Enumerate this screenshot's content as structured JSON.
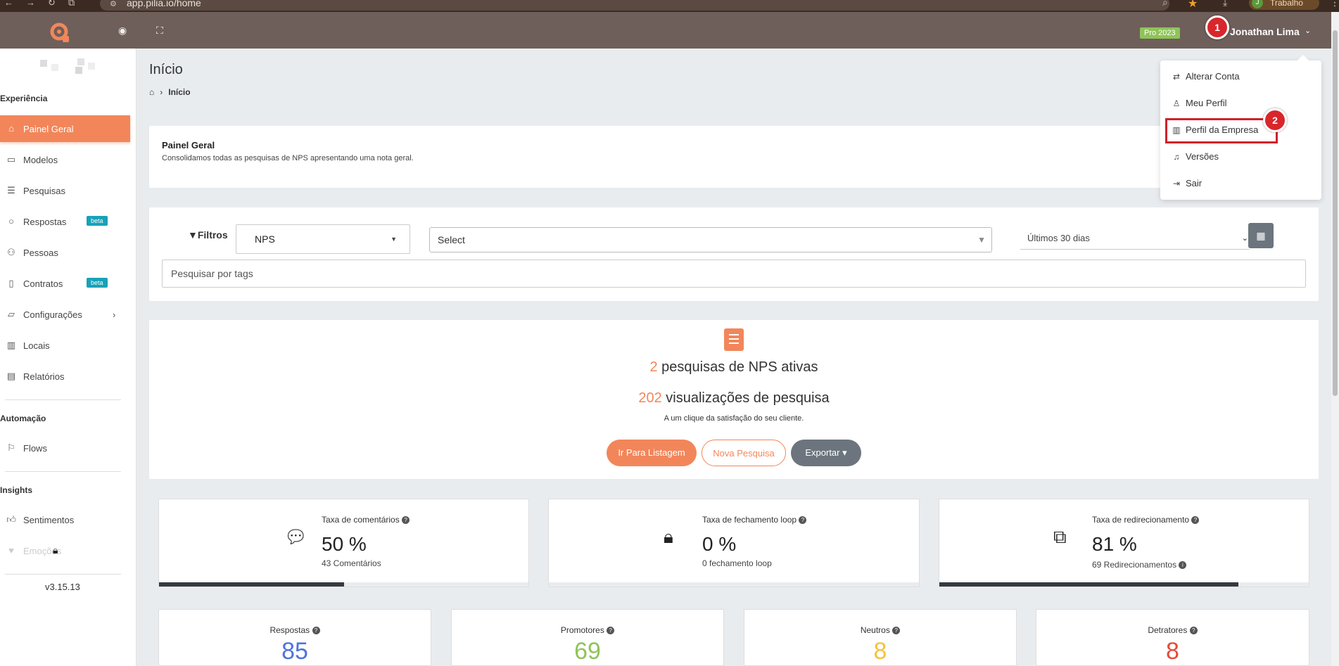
{
  "browser": {
    "url": "app.pilia.io/home",
    "profile_label": "Trabalho",
    "profile_initial": "J"
  },
  "topbar": {
    "plan_badge": "Pro 2023",
    "user_name": "Jonathan Lima"
  },
  "steps": {
    "one": "1",
    "two": "2"
  },
  "sidebar": {
    "section_experiencia": "Experiência",
    "section_automacao": "Automação",
    "section_insights": "Insights",
    "items": {
      "painel": "Painel Geral",
      "modelos": "Modelos",
      "pesquisas": "Pesquisas",
      "respostas": "Respostas",
      "pessoas": "Pessoas",
      "contratos": "Contratos",
      "configuracoes": "Configurações",
      "locais": "Locais",
      "relatorios": "Relatórios",
      "flows": "Flows",
      "sentimentos": "Sentimentos",
      "emocoes": "Emoções"
    },
    "beta_label": "beta",
    "version": "v3.15.13"
  },
  "page": {
    "title": "Início",
    "breadcrumb_current": "Início"
  },
  "info_card": {
    "title": "Painel Geral",
    "description": "Consolidamos todas as pesquisas de NPS apresentando uma nota geral."
  },
  "filters": {
    "label": "Filtros",
    "type_value": "NPS",
    "select_placeholder": "Select",
    "date_value": "Últimos 30 dias",
    "tags_placeholder": "Pesquisar por tags"
  },
  "summary": {
    "active_count": "2",
    "active_text": " pesquisas de NPS ativas",
    "views_count": "202",
    "views_text": " visualizações de pesquisa",
    "tagline": "A um clique da satisfação do seu cliente.",
    "btn_list": "Ir Para Listagem",
    "btn_new": "Nova Pesquisa",
    "btn_export": "Exportar"
  },
  "stats": [
    {
      "label": "Taxa de comentários",
      "value": "50 %",
      "sub": "43 Comentários",
      "progress": 0.5
    },
    {
      "label": "Taxa de fechamento loop",
      "value": "0 %",
      "sub": "0 fechamento loop",
      "progress": 0
    },
    {
      "label": "Taxa de redirecionamento",
      "value": "81 %",
      "sub": "69 Redirecionamentos",
      "progress": 0.81
    }
  ],
  "counts": [
    {
      "label": "Respostas",
      "value": "85",
      "color": "#4e73df"
    },
    {
      "label": "Promotores",
      "value": "69",
      "color": "#8fc459"
    },
    {
      "label": "Neutros",
      "value": "8",
      "color": "#f6c23e"
    },
    {
      "label": "Detratores",
      "value": "8",
      "color": "#e74a3b"
    }
  ],
  "dropdown": {
    "alterar": "Alterar Conta",
    "perfil": "Meu Perfil",
    "empresa": "Perfil da Empresa",
    "versoes": "Versões",
    "sair": "Sair"
  }
}
